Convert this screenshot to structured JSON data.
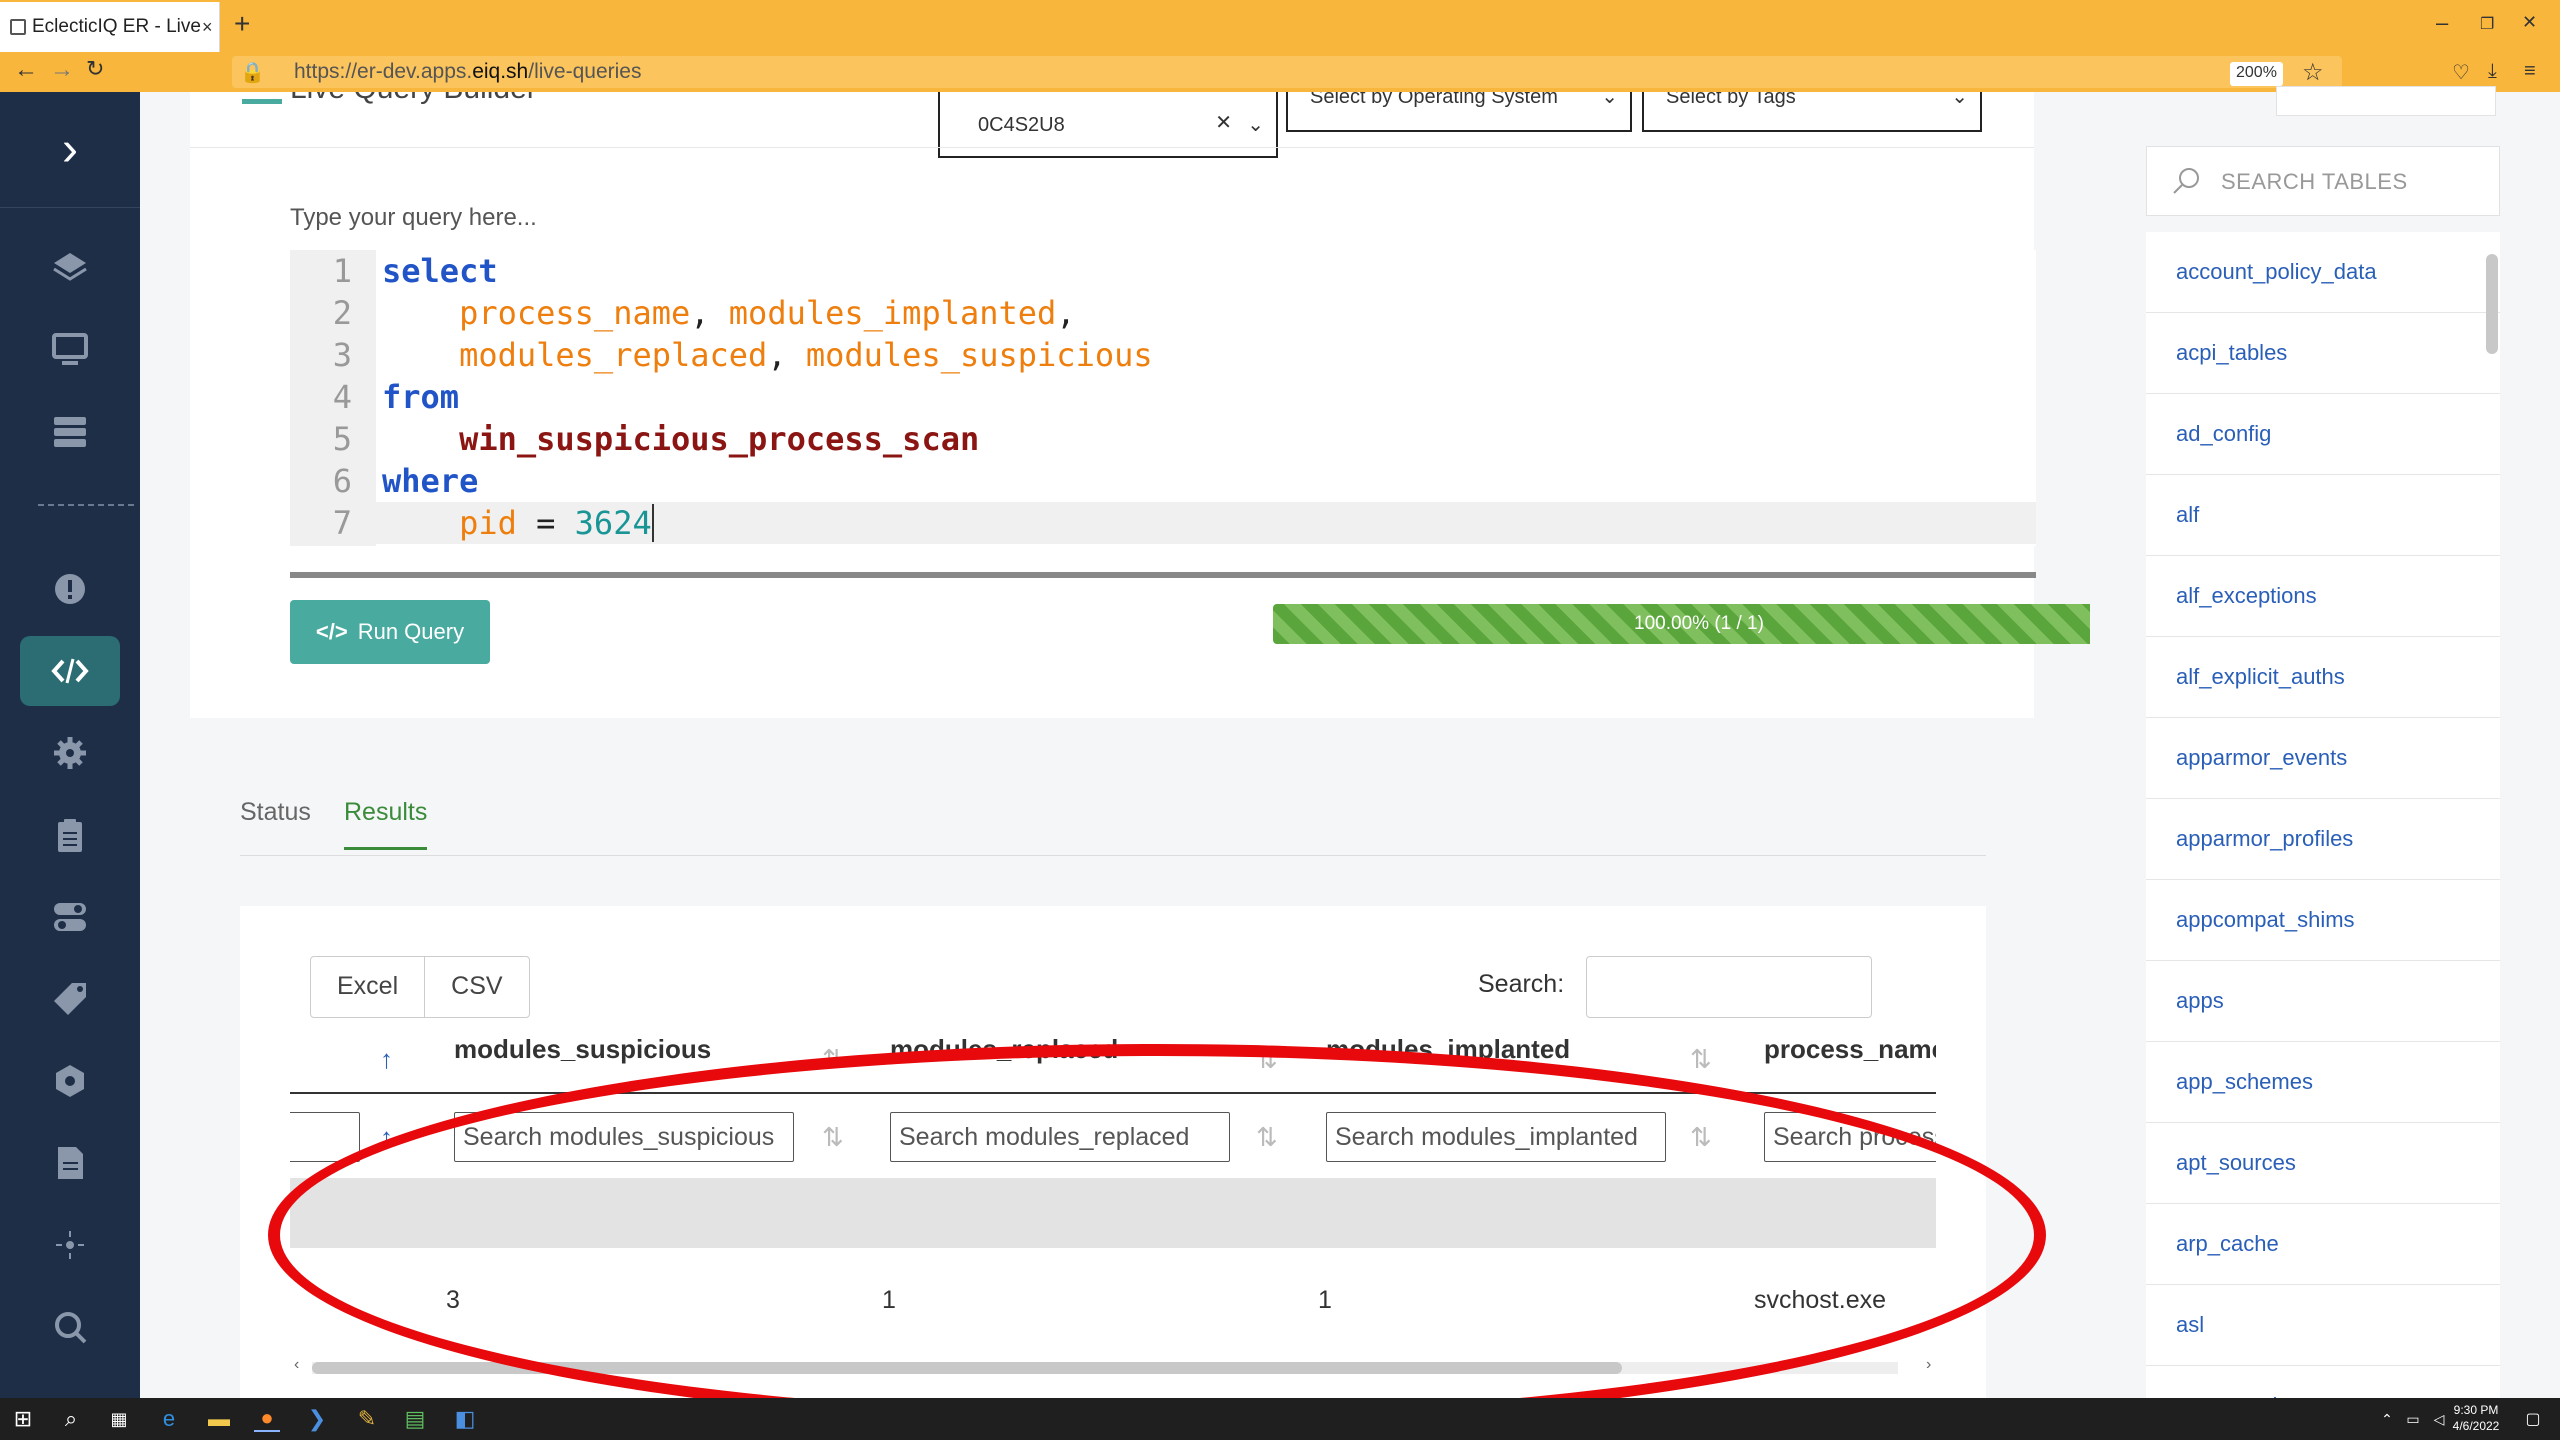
{
  "browser": {
    "tab_title": "EclecticIQ ER - Live",
    "tab_close": "×",
    "new_tab": "+",
    "url_prefix": "https://er-dev.apps.",
    "url_domain": "eiq.sh",
    "url_path": "/live-queries",
    "zoom": "200%",
    "window_controls": [
      "–",
      "❐",
      "✕"
    ]
  },
  "sidebar": {
    "toggle_icon": "chevron-right-icon",
    "items": [
      "layers-icon",
      "monitor-icon",
      "server-icon",
      "alert-icon",
      "code-icon",
      "gear-icon",
      "clipboard-icon",
      "toggle-icon",
      "tag-icon",
      "hexagon-icon",
      "document-icon",
      "crosshair-icon",
      "search-icon"
    ],
    "active": "code-icon",
    "accent": "#2b6d72"
  },
  "builder": {
    "title": "Live Query Builder",
    "host_selected": "0C4S2U8",
    "os_placeholder": "Select by Operating System",
    "tags_placeholder": "Select by Tags",
    "query_label": "Type your query here...",
    "run_label": "Run Query",
    "progress_text": "100.00% (1 / 1)",
    "progress": 1.0,
    "progress_color": "#5aa53c",
    "button_color": "#49aaa0"
  },
  "code": {
    "l1_kw": "select",
    "l2_a": "process_name",
    "l2_b": "modules_implanted",
    "l3_a": "modules_replaced",
    "l3_b": "modules_suspicious",
    "l4_kw": "from",
    "l5_tbl": "win_suspicious_process_scan",
    "l6_kw": "where",
    "l7_col": "pid",
    "l7_op": "=",
    "l7_num": "3624",
    "comma": ","
  },
  "results": {
    "tab_status": "Status",
    "tab_results": "Results",
    "excel": "Excel",
    "csv": "CSV",
    "search_label": "Search:",
    "columns": [
      "modules_suspicious",
      "modules_replaced",
      "modules_implanted",
      "process_name"
    ],
    "filters": [
      "Search modules_suspicious",
      "Search modules_replaced",
      "Search modules_implanted",
      "Search process_name"
    ],
    "row": [
      "3",
      "1",
      "1",
      "svchost.exe"
    ],
    "annotation_color": "#e8090c"
  },
  "tables_panel": {
    "search_placeholder": "SEARCH TABLES",
    "items": [
      "account_policy_data",
      "acpi_tables",
      "ad_config",
      "alf",
      "alf_exceptions",
      "alf_explicit_auths",
      "apparmor_events",
      "apparmor_profiles",
      "appcompat_shims",
      "apps",
      "app_schemes",
      "apt_sources",
      "arp_cache",
      "asl",
      "atom_packages"
    ]
  },
  "taskbar": {
    "time": "9:30 PM",
    "date": "4/6/2022"
  }
}
